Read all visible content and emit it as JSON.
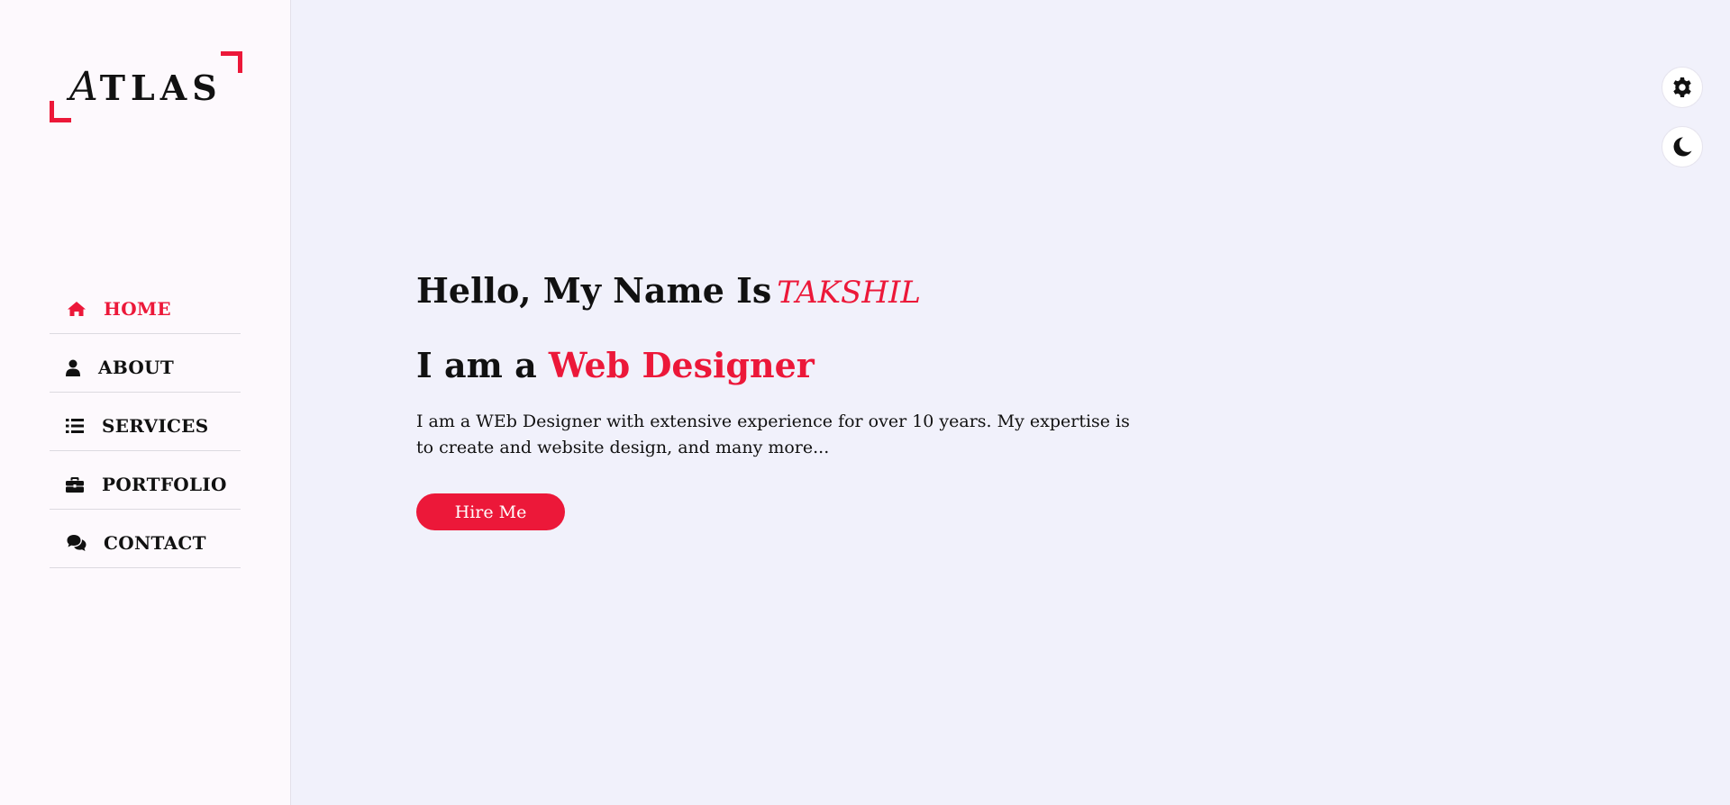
{
  "logo": {
    "first_letter": "A",
    "rest": "TLAS"
  },
  "nav": {
    "items": [
      {
        "label": "HOME",
        "icon": "home-icon",
        "active": true
      },
      {
        "label": "ABOUT",
        "icon": "user-icon"
      },
      {
        "label": "SERVICES",
        "icon": "list-icon"
      },
      {
        "label": "PORTFOLIO",
        "icon": "briefcase-icon"
      },
      {
        "label": "CONTACT",
        "icon": "comments-icon"
      }
    ]
  },
  "hero": {
    "hello_prefix": "Hello, My Name Is",
    "name": "TAKSHIL",
    "role_prefix": "I am a",
    "role": "Web Designer",
    "description": "I am a WEb Designer with extensive experience for over 10 years. My expertise is to create and website design, and many more...",
    "button_label": "Hire Me"
  },
  "toolbar": {
    "settings_icon": "gear-icon",
    "theme_icon": "moon-icon"
  },
  "colors": {
    "accent": "#ec1839",
    "sidebar_bg": "#fdf9fd",
    "main_bg": "#f1f1fb"
  }
}
